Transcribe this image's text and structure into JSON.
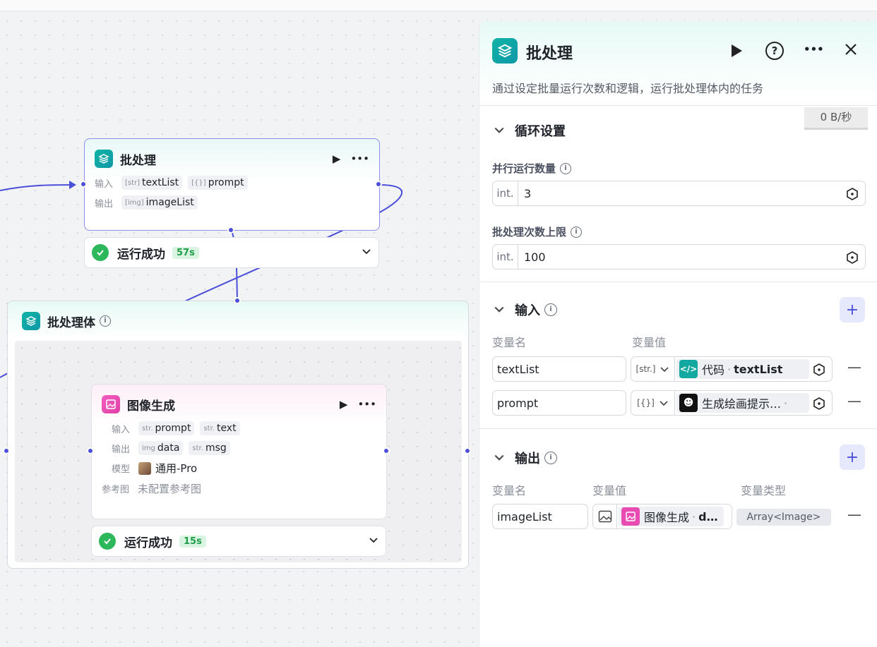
{
  "canvas": {
    "batch_node": {
      "title": "批处理",
      "input_label": "输入",
      "output_label": "输出",
      "inputs": [
        {
          "type": "[str]",
          "name": "textList"
        },
        {
          "type": "[{}]",
          "name": "prompt"
        }
      ],
      "outputs": [
        {
          "type": "[img]",
          "name": "imageList"
        }
      ],
      "status_text": "运行成功",
      "status_time": "57s"
    },
    "batch_body": {
      "title": "批处理体"
    },
    "image_node": {
      "title": "图像生成",
      "input_label": "输入",
      "output_label": "输出",
      "model_label": "模型",
      "ref_label": "参考图",
      "inputs": [
        {
          "type": "str.",
          "name": "prompt"
        },
        {
          "type": "str.",
          "name": "text"
        }
      ],
      "outputs": [
        {
          "type": "img",
          "name": "data"
        },
        {
          "type": "str.",
          "name": "msg"
        }
      ],
      "model": "通用-Pro",
      "ref_value": "未配置参考图",
      "status_text": "运行成功",
      "status_time": "15s"
    }
  },
  "panel": {
    "title": "批处理",
    "description": "通过设定批量运行次数和逻辑，运行批处理体内的任务",
    "net_speed": "0 B/秒",
    "loop_section": {
      "title": "循环设置",
      "parallel_label": "并行运行数量",
      "parallel_type": "int.",
      "parallel_value": "3",
      "limit_label": "批处理次数上限",
      "limit_type": "int.",
      "limit_value": "100"
    },
    "input_section": {
      "title": "输入",
      "col_name": "变量名",
      "col_value": "变量值",
      "rows": [
        {
          "name": "textList",
          "type": "[str.]",
          "ref_source": "代码",
          "ref_var": "textList"
        },
        {
          "name": "prompt",
          "type": "[{}]",
          "ref_source": "生成绘画提示…",
          "ref_var": ""
        }
      ]
    },
    "output_section": {
      "title": "输出",
      "col_name": "变量名",
      "col_value": "变量值",
      "col_type": "变量类型",
      "rows": [
        {
          "name": "imageList",
          "ref_source": "图像生成",
          "ref_var": "d…",
          "var_type": "Array<Image>"
        }
      ]
    }
  }
}
